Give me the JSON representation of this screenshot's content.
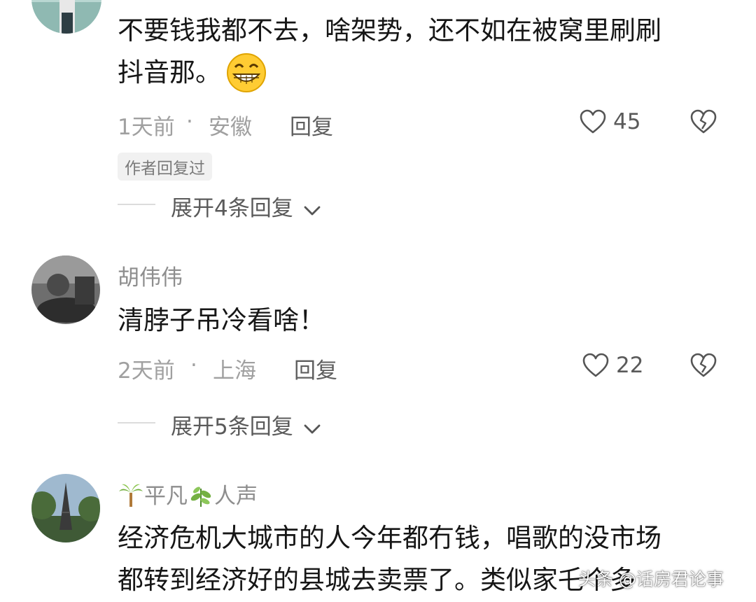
{
  "comments": [
    {
      "text_lines": [
        "不要钱我都不去，啥架势，还不如在被窝里刷刷",
        "抖音那。"
      ],
      "emoji_icon": "grinning-face-icon",
      "time": "1天前",
      "separator": "·",
      "location": "安徽",
      "reply_label": "回复",
      "like_count": "45",
      "badge": "作者回复过",
      "expand_label": "展开4条回复"
    },
    {
      "username": "胡伟伟",
      "text_lines": [
        "清脖子吊冷看啥！"
      ],
      "time": "2天前",
      "separator": "·",
      "location": "上海",
      "reply_label": "回复",
      "like_count": "22",
      "expand_label": "展开5条回复"
    },
    {
      "username_parts": [
        "平凡",
        "人声"
      ],
      "username_icons": [
        "palm-tree-icon",
        "herb-icon"
      ],
      "text_lines": [
        "经济危机大城市的人今年都冇钱，唱歌的没市场",
        "都转到经济好的县城去卖票了。类似家乇个多"
      ]
    }
  ],
  "watermark": "头条 @话房君论事",
  "colors": {
    "text": "#161616",
    "meta": "#a0a0a0",
    "username": "#8e8e8e",
    "badge_bg": "#f1f1f1"
  }
}
